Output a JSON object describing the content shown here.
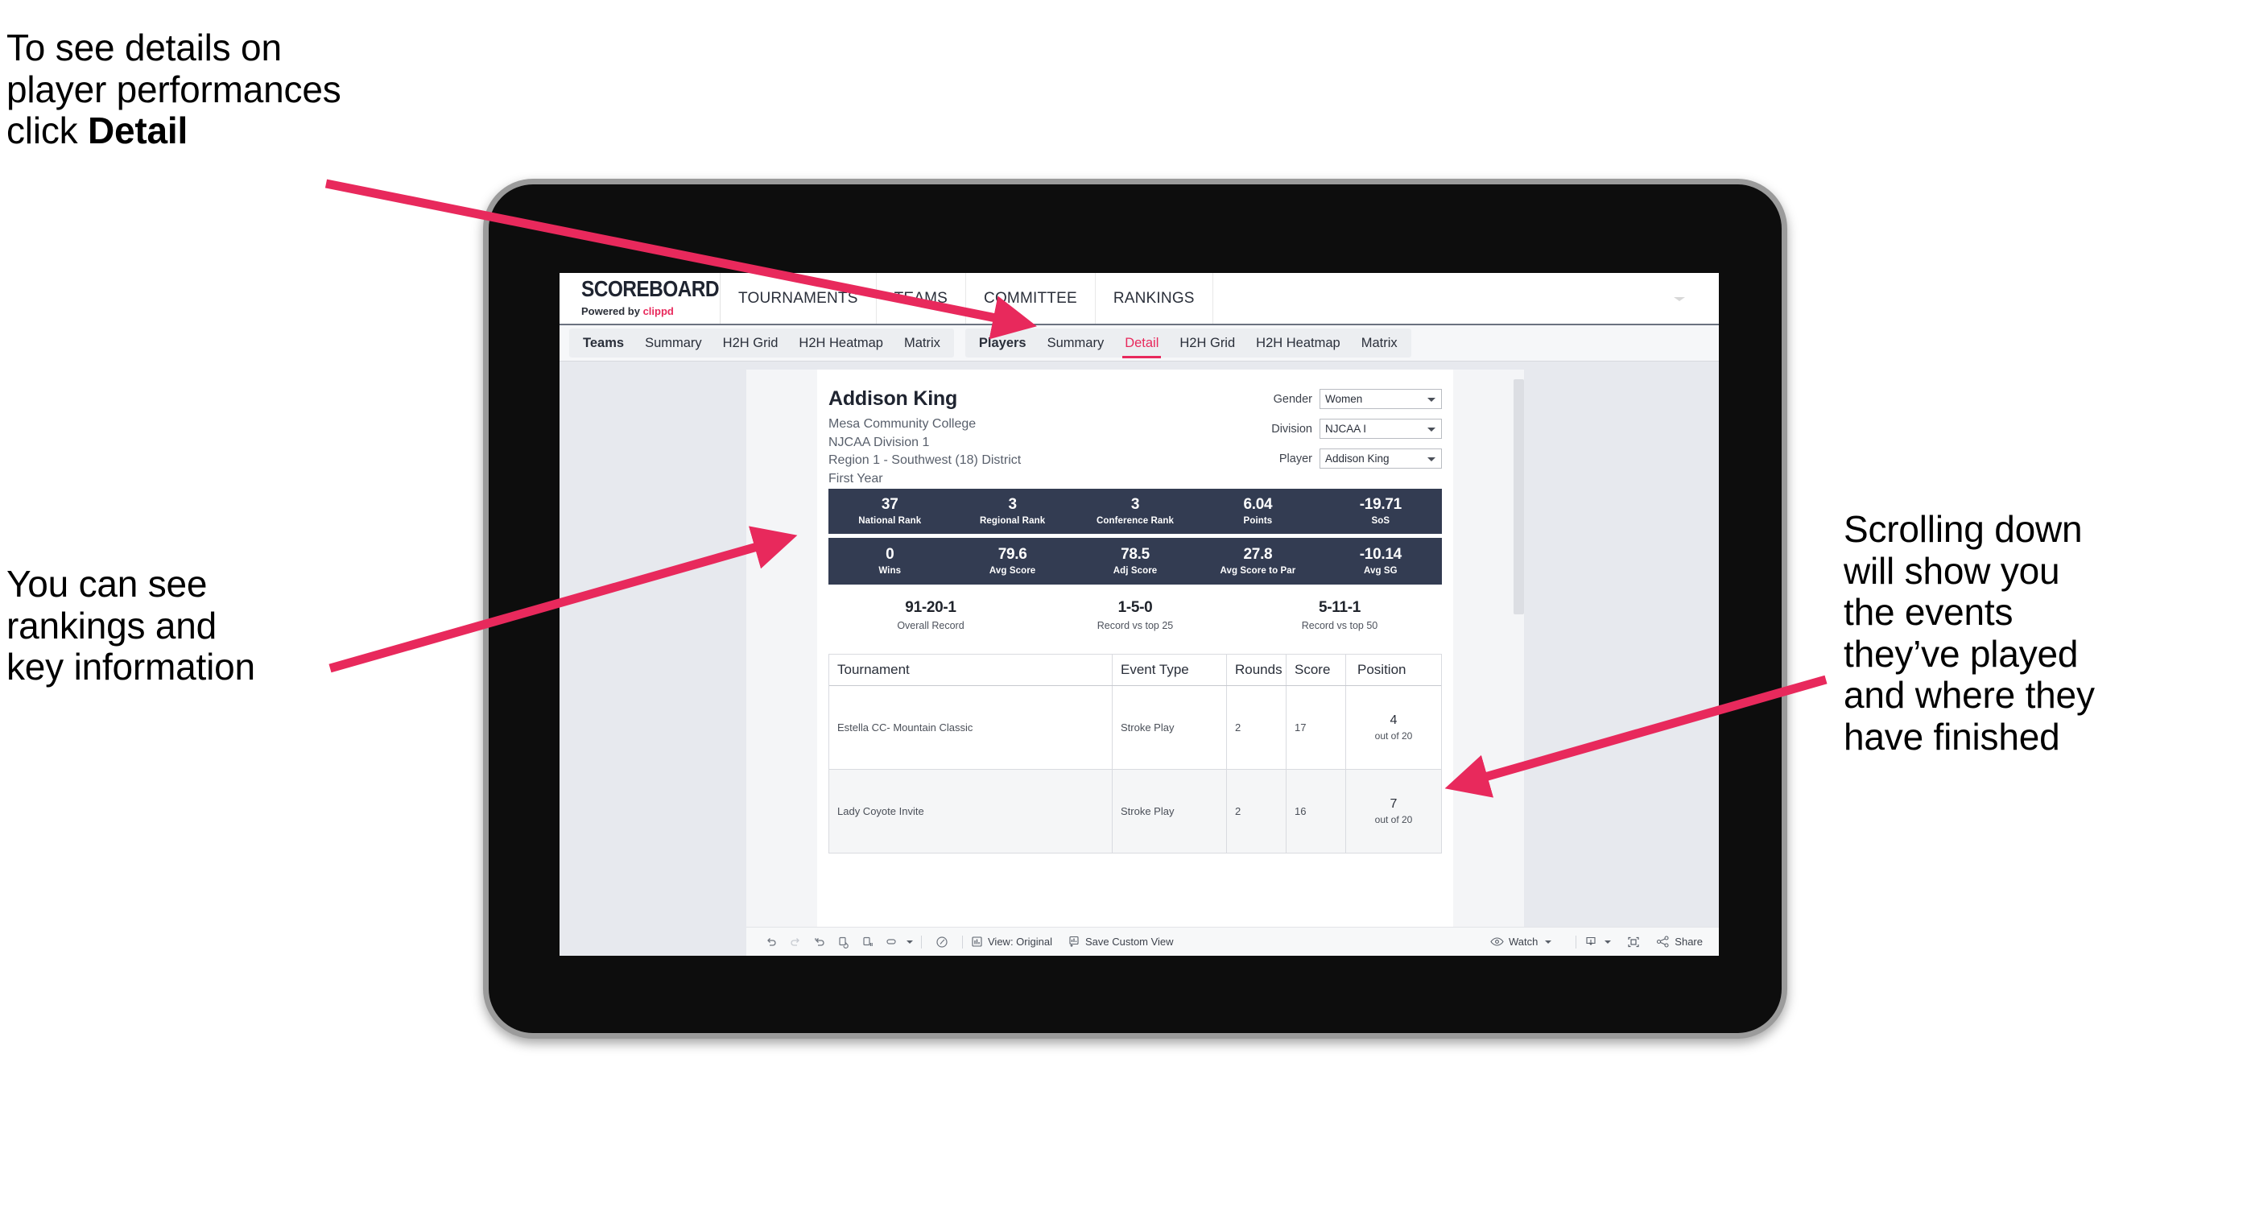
{
  "annotations": {
    "detail": "To see details on\nplayer performances\nclick ",
    "detail_bold": "Detail",
    "rankings": "You can see\nrankings and\nkey information",
    "scrolling": "Scrolling down\nwill show you\nthe events\nthey’ve played\nand where they\nhave finished"
  },
  "colors": {
    "accent": "#e8295c",
    "stat_bar": "#333c52",
    "tablet_frame": "#9b9b9b"
  },
  "app": {
    "brand": {
      "title": "SCOREBOARD",
      "powered_prefix": "Powered by ",
      "powered_name": "clippd"
    },
    "nav": [
      {
        "label": "TOURNAMENTS"
      },
      {
        "label": "TEAMS"
      },
      {
        "label": "COMMITTEE"
      },
      {
        "label": "RANKINGS"
      }
    ],
    "subtabs": {
      "teams_group": [
        "Teams",
        "Summary",
        "H2H Grid",
        "H2H Heatmap",
        "Matrix"
      ],
      "players_group": [
        "Players",
        "Summary",
        "Detail",
        "H2H Grid",
        "H2H Heatmap",
        "Matrix"
      ],
      "active": "Detail"
    }
  },
  "player": {
    "name": "Addison King",
    "school": "Mesa Community College",
    "division": "NJCAA Division 1",
    "region": "Region 1 - Southwest (18) District",
    "year": "First Year"
  },
  "selectors": [
    {
      "label": "Gender",
      "value": "Women"
    },
    {
      "label": "Division",
      "value": "NJCAA I"
    },
    {
      "label": "Player",
      "value": "Addison King"
    }
  ],
  "stats_row1": [
    {
      "value": "37",
      "label": "National Rank"
    },
    {
      "value": "3",
      "label": "Regional Rank"
    },
    {
      "value": "3",
      "label": "Conference Rank"
    },
    {
      "value": "6.04",
      "label": "Points"
    },
    {
      "value": "-19.71",
      "label": "SoS"
    }
  ],
  "stats_row2": [
    {
      "value": "0",
      "label": "Wins"
    },
    {
      "value": "79.6",
      "label": "Avg Score"
    },
    {
      "value": "78.5",
      "label": "Adj Score"
    },
    {
      "value": "27.8",
      "label": "Avg Score to Par"
    },
    {
      "value": "-10.14",
      "label": "Avg SG"
    }
  ],
  "records": [
    {
      "value": "91-20-1",
      "label": "Overall Record"
    },
    {
      "value": "1-5-0",
      "label": "Record vs top 25"
    },
    {
      "value": "5-11-1",
      "label": "Record vs top 50"
    }
  ],
  "table": {
    "headers": [
      "Tournament",
      "Event Type",
      "Rounds",
      "Score",
      "Position"
    ],
    "rows": [
      {
        "tournament": "Estella CC- Mountain Classic",
        "event_type": "Stroke Play",
        "rounds": "2",
        "score": "17",
        "position": "4",
        "position_sub": "out of 20"
      },
      {
        "tournament": "Lady Coyote Invite",
        "event_type": "Stroke Play",
        "rounds": "2",
        "score": "16",
        "position": "7",
        "position_sub": "out of 20"
      }
    ]
  },
  "toolbar": {
    "view_label": "View: Original",
    "save_label": "Save Custom View",
    "watch_label": "Watch",
    "share_label": "Share"
  }
}
